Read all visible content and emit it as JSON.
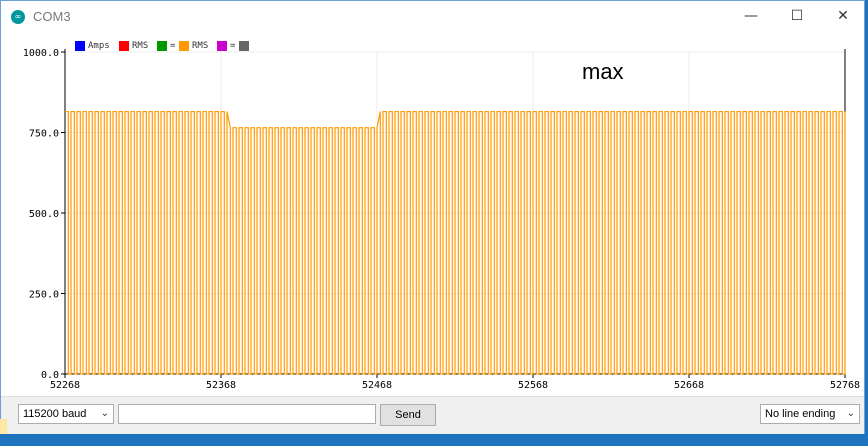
{
  "window": {
    "title": "COM3",
    "app_icon": "arduino-infinity-icon",
    "minimize_glyph": "—",
    "maximize_glyph": "☐",
    "close_glyph": "✕"
  },
  "legend": [
    {
      "label": "Amps",
      "color": "#0000ff"
    },
    {
      "label": "RMS",
      "color": "#ff0000"
    },
    {
      "label": "=",
      "color": "#009900"
    },
    {
      "label": "RMS",
      "color": "#ff9900"
    },
    {
      "label": "=",
      "color": "#cc00cc"
    },
    {
      "label": "",
      "color": "#666666"
    }
  ],
  "annotation": "max",
  "chart_data": {
    "type": "line",
    "ylim": [
      0,
      1000
    ],
    "xlim": [
      52268,
      52768
    ],
    "yticks": [
      "1000.0",
      "750.0",
      "500.0",
      "250.0",
      "0.0"
    ],
    "xticks": [
      "52268",
      "52368",
      "52468",
      "52568",
      "52668",
      "52768"
    ],
    "series": [
      {
        "name": "RMS",
        "color": "#ff9900",
        "description_values": {
          "high_level_left": 815,
          "high_level_middle": 765,
          "high_level_right": 815,
          "low_level": 0
        }
      }
    ]
  },
  "bottom": {
    "baud": "115200 baud",
    "input_value": "",
    "send": "Send",
    "line_ending": "No line ending",
    "chevron": "⌄"
  }
}
